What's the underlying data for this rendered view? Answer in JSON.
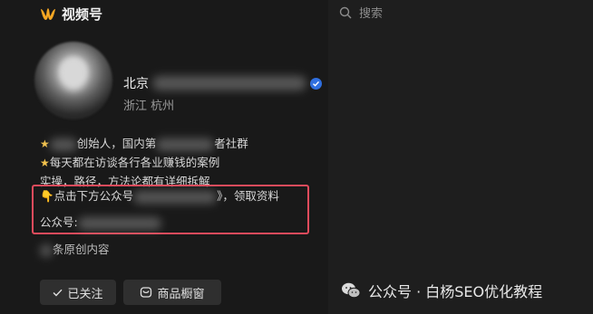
{
  "app": {
    "name": "视频号"
  },
  "search": {
    "placeholder": "搜索"
  },
  "profile": {
    "name_visible": "北京",
    "location": "浙江 杭州"
  },
  "bio": {
    "line1_a": "创始人，国内第",
    "line1_b": "者社群",
    "line2": "每天都在访谈各行各业赚钱的案例",
    "line3": "实操，路径，方法论都有详细拆解",
    "cta_a": "点击下方公众号",
    "cta_b": "》，领取资料",
    "gzh_label": "公众号:",
    "count_suffix": "条原创内容"
  },
  "buttons": {
    "follow": "已关注",
    "shop": "商品橱窗"
  },
  "watermark": {
    "text": "公众号 · 白杨SEO优化教程"
  },
  "colors": {
    "background": "#191919",
    "highlight": "#e24b5c",
    "verified": "#2f6fe0",
    "star": "#f3c34d"
  }
}
